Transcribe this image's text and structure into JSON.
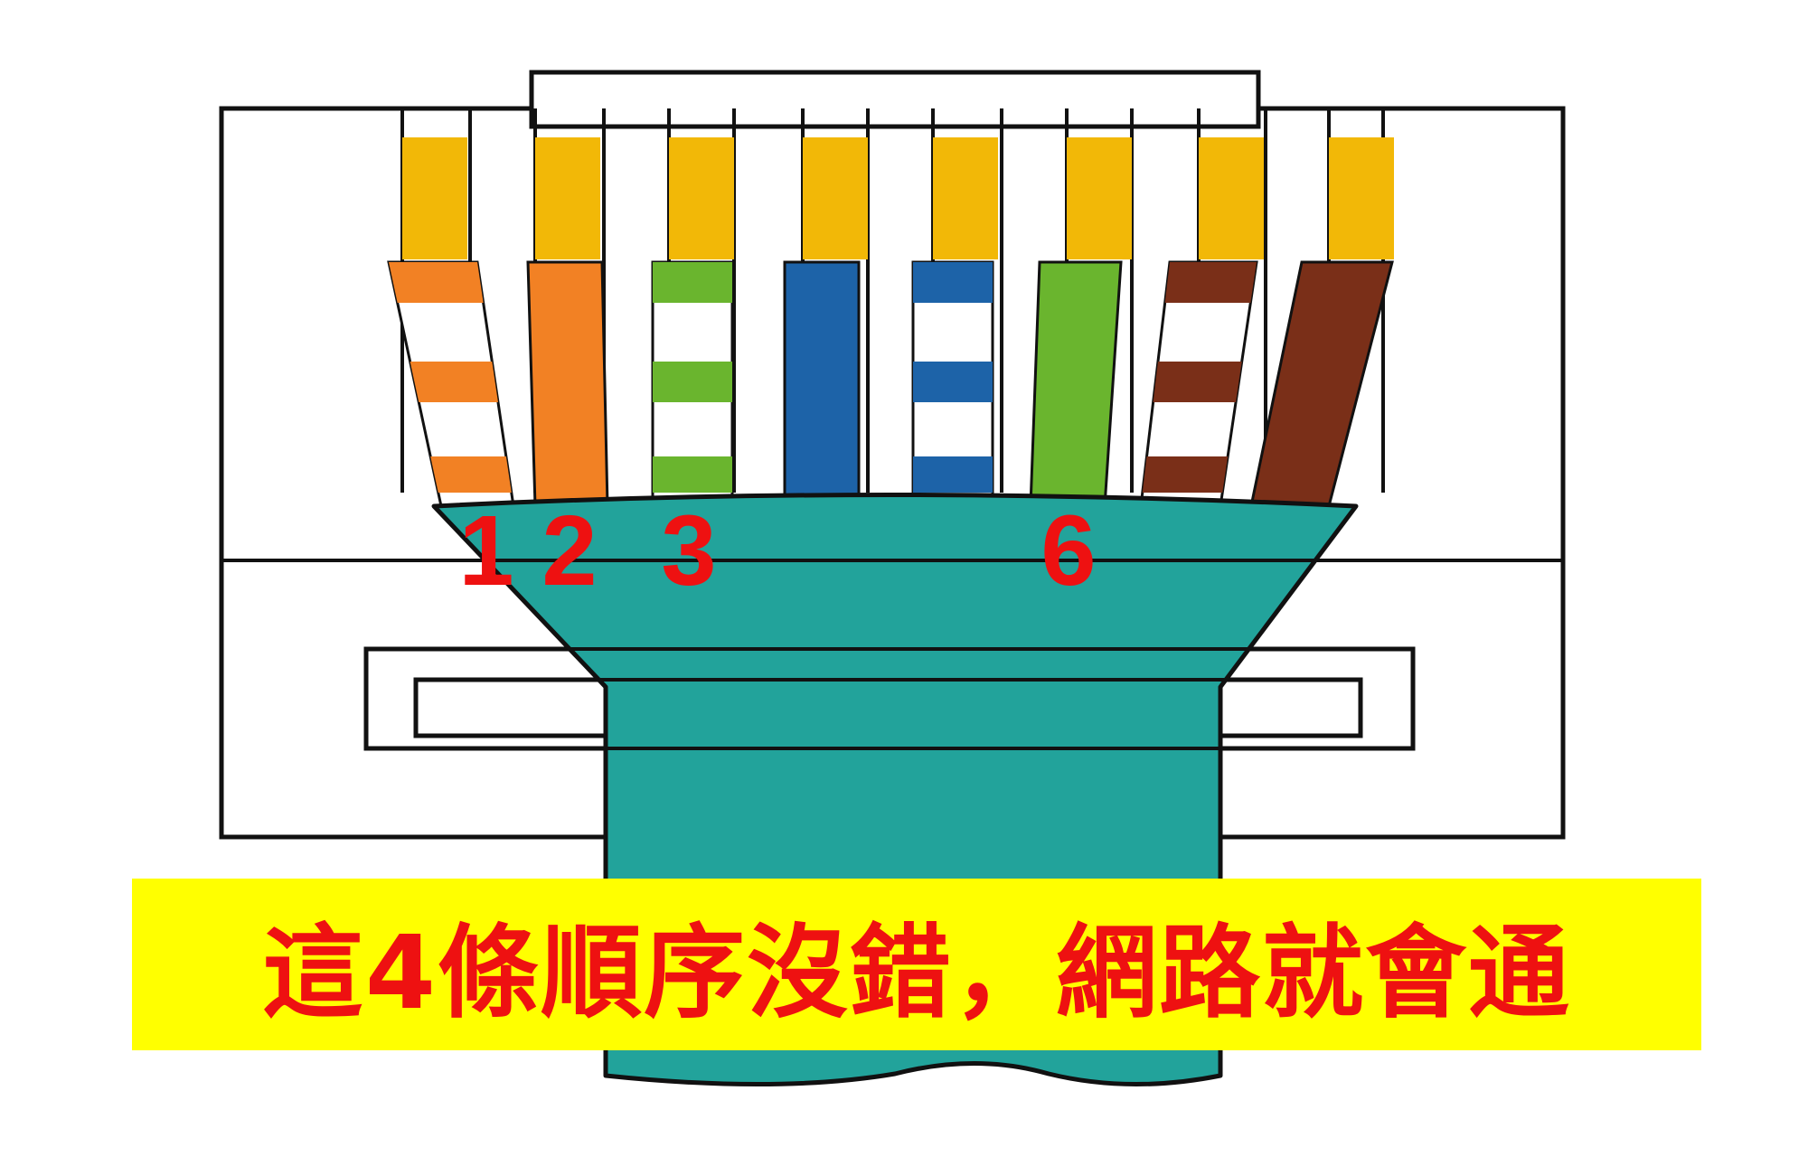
{
  "colors": {
    "housing_stroke": "#111111",
    "gold_contact": "#f2b807",
    "jacket": "#22a39b",
    "jacket_stroke": "#111111",
    "pin_label": "#ee1111",
    "caption_bg": "#ffff00",
    "caption_text": "#ee1111"
  },
  "wires": [
    {
      "name": "white-orange",
      "base": "#ffffff",
      "stripe": "#f28124",
      "striped": true
    },
    {
      "name": "orange",
      "base": "#f28124",
      "striped": false
    },
    {
      "name": "white-green",
      "base": "#ffffff",
      "stripe": "#6ab52e",
      "striped": true
    },
    {
      "name": "blue",
      "base": "#1d63a8",
      "striped": false
    },
    {
      "name": "white-blue",
      "base": "#ffffff",
      "stripe": "#1d63a8",
      "striped": true
    },
    {
      "name": "green",
      "base": "#6ab52e",
      "striped": false
    },
    {
      "name": "white-brown",
      "base": "#ffffff",
      "stripe": "#7a2f18",
      "striped": true
    },
    {
      "name": "brown",
      "base": "#7a2f18",
      "striped": false
    }
  ],
  "pin_labels": [
    "1",
    "2",
    "3",
    "6"
  ],
  "caption": "這4條順序沒錯，網路就會通"
}
